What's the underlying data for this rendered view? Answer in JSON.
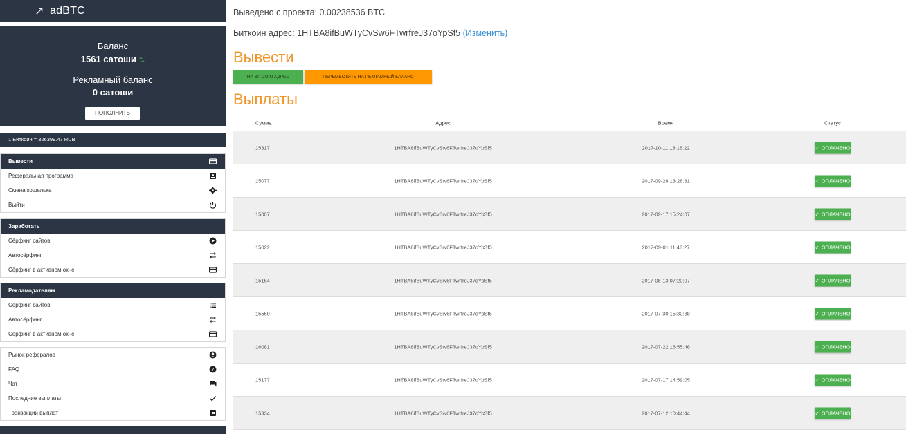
{
  "app": {
    "title": "adBTC",
    "logo_icon": "↗"
  },
  "balance": {
    "label": "Баланс",
    "value": "1561 сатоши",
    "ad_label": "Рекламный баланс",
    "ad_value": "0 сатоши",
    "topup_label": "ПОПОЛНИТЬ"
  },
  "rate": "1 Биткоин = 326399.47 RUB",
  "menus": {
    "withdraw": {
      "title": "Вывести",
      "items": [
        "Реферальная программа",
        "Смена кошелька",
        "Выйти"
      ]
    },
    "earn": {
      "title": "Заработать",
      "items": [
        "Сёрфинг сайтов",
        "Автосёрфинг",
        "Сёрфинг в активном окне"
      ]
    },
    "advertisers": {
      "title": "Рекламодателям",
      "items": [
        "Сёрфинг сайтов",
        "Автосёрфинг",
        "Сёрфинг в активном окне"
      ]
    },
    "misc": {
      "items": [
        "Рынок рефералов",
        "FAQ",
        "Чат",
        "Последние выплаты",
        "Транзакции выплат"
      ]
    }
  },
  "main": {
    "withdrawn_text": "Выведено с проекта: 0.00238536 BTC",
    "address_text": "Биткоин адрес: 1HTBA8ifBuWTyCvSw6FTwrfreJ37oYpSf5",
    "change_link": "(Изменить)",
    "withdraw_heading": "Вывести",
    "btn_bitcoin": "НА BITCOIN АДРЕС",
    "btn_move": "ПЕРЕМЕСТИТЬ НА РЕКЛАМНЫЙ БАЛАНС",
    "payouts_heading": "Выплаты"
  },
  "table": {
    "headers": {
      "sum": "Сумма",
      "address": "Адрес",
      "time": "Время",
      "status": "Статус"
    },
    "rows": [
      {
        "sum": "15317",
        "address": "1HTBA8ifBuWTyCvSw6FTwrfreJ37oYpSf5",
        "time": "2017-10-11 18:18:22",
        "status": "ОПЛАЧЕНО"
      },
      {
        "sum": "15077",
        "address": "1HTBA8ifBuWTyCvSw6FTwrfreJ37oYpSf5",
        "time": "2017-09-28 13:28:31",
        "status": "ОПЛАЧЕНО"
      },
      {
        "sum": "15007",
        "address": "1HTBA8ifBuWTyCvSw6FTwrfreJ37oYpSf5",
        "time": "2017-09-17 15:24:07",
        "status": "ОПЛАЧЕНО"
      },
      {
        "sum": "15022",
        "address": "1HTBA8ifBuWTyCvSw6FTwrfreJ37oYpSf5",
        "time": "2017-09-01 11:48:27",
        "status": "ОПЛАЧЕНО"
      },
      {
        "sum": "15164",
        "address": "1HTBA8ifBuWTyCvSw6FTwrfreJ37oYpSf5",
        "time": "2017-08-13 07:20:07",
        "status": "ОПЛАЧЕНО"
      },
      {
        "sum": "15550",
        "address": "1HTBA8ifBuWTyCvSw6FTwrfreJ37oYpSf5",
        "time": "2017-07-30 15:30:38",
        "status": "ОПЛАЧЕНО"
      },
      {
        "sum": "16081",
        "address": "1HTBA8ifBuWTyCvSw6FTwrfreJ37oYpSf5",
        "time": "2017-07-22 16:55:46",
        "status": "ОПЛАЧЕНО"
      },
      {
        "sum": "15177",
        "address": "1HTBA8ifBuWTyCvSw6FTwrfreJ37oYpSf5",
        "time": "2017-07-17 14:59:05",
        "status": "ОПЛАЧЕНО"
      },
      {
        "sum": "15334",
        "address": "1HTBA8ifBuWTyCvSw6FTwrfreJ37oYpSf5",
        "time": "2017-07-12 10:44:44",
        "status": "ОПЛАЧЕНО"
      }
    ]
  },
  "colors": {
    "dark": "#2b3544",
    "accent": "#f0962a",
    "green": "#4caf50",
    "orange": "#ff9800",
    "link": "#3b8fd4"
  }
}
